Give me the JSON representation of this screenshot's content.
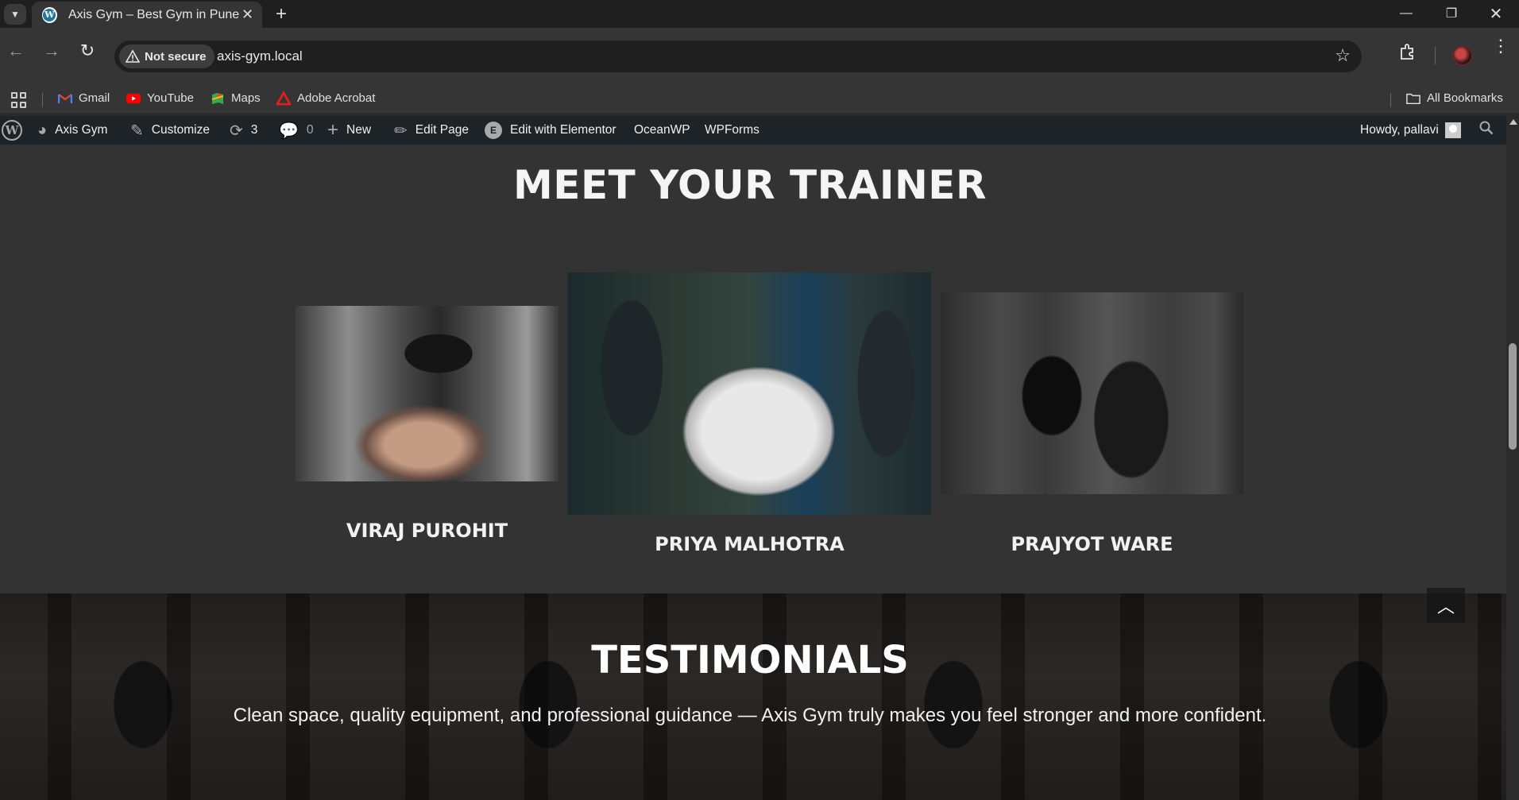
{
  "browser": {
    "tab_title": "Axis Gym – Best Gym in Pune",
    "tab_favicon": "W",
    "security_label": "Not secure",
    "url": "axis-gym.local"
  },
  "bookmarks": [
    {
      "label": "Gmail",
      "icon": "gmail-icon",
      "color": "#ea4335"
    },
    {
      "label": "YouTube",
      "icon": "youtube-icon",
      "color": "#ff0000"
    },
    {
      "label": "Maps",
      "icon": "maps-icon",
      "color": "#34a853"
    },
    {
      "label": "Adobe Acrobat",
      "icon": "acrobat-icon",
      "color": "#e0201c"
    }
  ],
  "all_bookmarks_label": "All Bookmarks",
  "admin_bar": {
    "site_name": "Axis Gym",
    "customize": "Customize",
    "updates_count": "3",
    "comments_count": "0",
    "new": "New",
    "edit_page": "Edit Page",
    "edit_elementor": "Edit with Elementor",
    "oceanwp": "OceanWP",
    "wpforms": "WPForms",
    "howdy": "Howdy, pallavi"
  },
  "trainers_section": {
    "heading": "MEET YOUR TRAINER",
    "trainers": [
      {
        "name": "VIRAJ PUROHIT"
      },
      {
        "name": "PRIYA MALHOTRA"
      },
      {
        "name": "PRAJYOT WARE"
      }
    ]
  },
  "testimonials_section": {
    "heading": "TESTIMONIALS",
    "quote": "Clean space, quality equipment, and professional guidance — Axis Gym truly makes you feel stronger and more confident."
  },
  "colors": {
    "admin_bar_bg": "#1d2327",
    "page_bg": "#333333",
    "wp_blue": "#21759b"
  }
}
